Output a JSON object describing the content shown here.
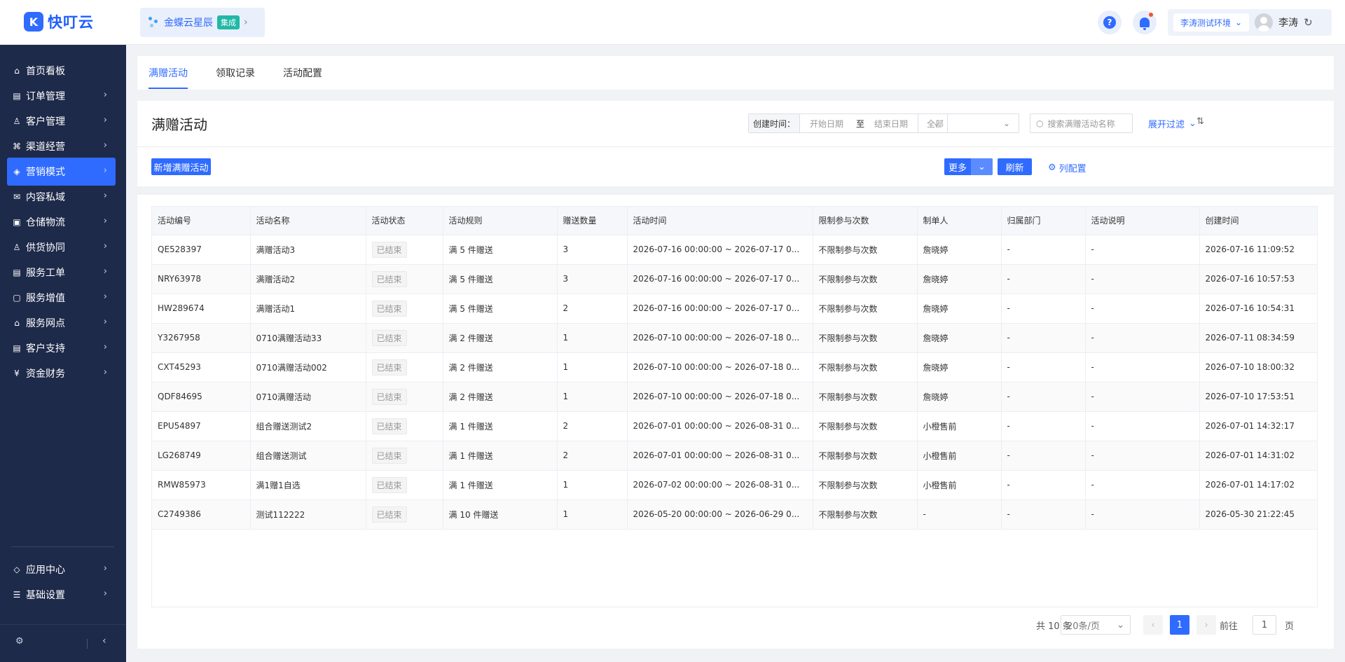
{
  "app": {
    "logo_mark": "K",
    "logo_text": "快叮云"
  },
  "app_switch": {
    "name": "金蝶云星辰",
    "badge": "集成"
  },
  "header": {
    "env": "李涛测试环境",
    "user": "李涛"
  },
  "sidebar": {
    "items": [
      {
        "label": "首页看板",
        "icon": "home-icon",
        "glyph": "⌂",
        "has_children": false
      },
      {
        "label": "订单管理",
        "icon": "order-icon",
        "glyph": "▤",
        "has_children": true
      },
      {
        "label": "客户管理",
        "icon": "user-icon",
        "glyph": "♙",
        "has_children": true
      },
      {
        "label": "渠道经营",
        "icon": "channel-icon",
        "glyph": "⌘",
        "has_children": true
      },
      {
        "label": "营销模式",
        "icon": "tag-icon",
        "glyph": "◈",
        "has_children": true,
        "active": true
      },
      {
        "label": "内容私域",
        "icon": "mail-icon",
        "glyph": "✉",
        "has_children": true
      },
      {
        "label": "仓储物流",
        "icon": "box-icon",
        "glyph": "▣",
        "has_children": true
      },
      {
        "label": "供货协同",
        "icon": "supply-icon",
        "glyph": "♙",
        "has_children": true
      },
      {
        "label": "服务工单",
        "icon": "ticket-icon",
        "glyph": "▤",
        "has_children": true
      },
      {
        "label": "服务增值",
        "icon": "bag-icon",
        "glyph": "▢",
        "has_children": true
      },
      {
        "label": "服务网点",
        "icon": "store-icon",
        "glyph": "⌂",
        "has_children": true
      },
      {
        "label": "客户支持",
        "icon": "support-icon",
        "glyph": "▤",
        "has_children": true
      },
      {
        "label": "资金财务",
        "icon": "finance-icon",
        "glyph": "¥",
        "has_children": true
      }
    ],
    "bottom_items": [
      {
        "label": "应用中心",
        "icon": "app-center-icon",
        "glyph": "◇"
      },
      {
        "label": "基础设置",
        "icon": "settings-list-icon",
        "glyph": "☰"
      }
    ]
  },
  "tabs": [
    "满赠活动",
    "领取记录",
    "活动配置"
  ],
  "page": {
    "title": "满赠活动",
    "filters": {
      "date_label": "创建时间：",
      "start_placeholder": "开始日期",
      "to": "至",
      "end_placeholder": "结束日期",
      "status_value": "全部",
      "search_placeholder": "搜索满赠活动名称",
      "expand_label": "展开过滤"
    },
    "buttons": {
      "new": "新增满赠活动",
      "more": "更多",
      "refresh": "刷新",
      "columns": "列配置"
    }
  },
  "table": {
    "columns": [
      "活动编号",
      "活动名称",
      "活动状态",
      "活动规则",
      "赠送数量",
      "活动时间",
      "限制参与次数",
      "制单人",
      "归属部门",
      "活动说明",
      "创建时间"
    ],
    "rows": [
      [
        "QE528397",
        "满赠活动3",
        "已结束",
        "满 5 件赠送",
        "3",
        "2026-07-16 00:00:00 ~ 2026-07-17 0...",
        "不限制参与次数",
        "詹晓婷",
        "-",
        "-",
        "2026-07-16 11:09:52"
      ],
      [
        "NRY63978",
        "满赠活动2",
        "已结束",
        "满 5 件赠送",
        "3",
        "2026-07-16 00:00:00 ~ 2026-07-17 0...",
        "不限制参与次数",
        "詹晓婷",
        "-",
        "-",
        "2026-07-16 10:57:53"
      ],
      [
        "HW289674",
        "满赠活动1",
        "已结束",
        "满 5 件赠送",
        "2",
        "2026-07-16 00:00:00 ~ 2026-07-17 0...",
        "不限制参与次数",
        "詹晓婷",
        "-",
        "-",
        "2026-07-16 10:54:31"
      ],
      [
        "Y3267958",
        "0710满赠活动33",
        "已结束",
        "满 2 件赠送",
        "1",
        "2026-07-10 00:00:00 ~ 2026-07-18 0...",
        "不限制参与次数",
        "詹晓婷",
        "-",
        "-",
        "2026-07-11 08:34:59"
      ],
      [
        "CXT45293",
        "0710满赠活动002",
        "已结束",
        "满 2 件赠送",
        "1",
        "2026-07-10 00:00:00 ~ 2026-07-18 0...",
        "不限制参与次数",
        "詹晓婷",
        "-",
        "-",
        "2026-07-10 18:00:32"
      ],
      [
        "QDF84695",
        "0710满赠活动",
        "已结束",
        "满 2 件赠送",
        "1",
        "2026-07-10 00:00:00 ~ 2026-07-18 0...",
        "不限制参与次数",
        "詹晓婷",
        "-",
        "-",
        "2026-07-10 17:53:51"
      ],
      [
        "EPU54897",
        "组合赠送测试2",
        "已结束",
        "满 1 件赠送",
        "2",
        "2026-07-01 00:00:00 ~ 2026-08-31 0...",
        "不限制参与次数",
        "小橙售前",
        "-",
        "-",
        "2026-07-01 14:32:17"
      ],
      [
        "LG268749",
        "组合赠送测试",
        "已结束",
        "满 1 件赠送",
        "2",
        "2026-07-01 00:00:00 ~ 2026-08-31 0...",
        "不限制参与次数",
        "小橙售前",
        "-",
        "-",
        "2026-07-01 14:31:02"
      ],
      [
        "RMW85973",
        "满1赠1自选",
        "已结束",
        "满 1 件赠送",
        "1",
        "2026-07-02 00:00:00 ~ 2026-08-31 0...",
        "不限制参与次数",
        "小橙售前",
        "-",
        "-",
        "2026-07-01 14:17:02"
      ],
      [
        "C2749386",
        "测试112222",
        "已结束",
        "满 10 件赠送",
        "1",
        "2026-05-20 00:00:00 ~ 2026-06-29 0...",
        "不限制参与次数",
        "-",
        "-",
        "-",
        "2026-05-30 21:22:45"
      ]
    ]
  },
  "pagination": {
    "total": "共 10 条",
    "page_size": "20条/页",
    "current": "1",
    "goto_label": "前往",
    "goto_value": "1",
    "goto_suffix": "页"
  }
}
